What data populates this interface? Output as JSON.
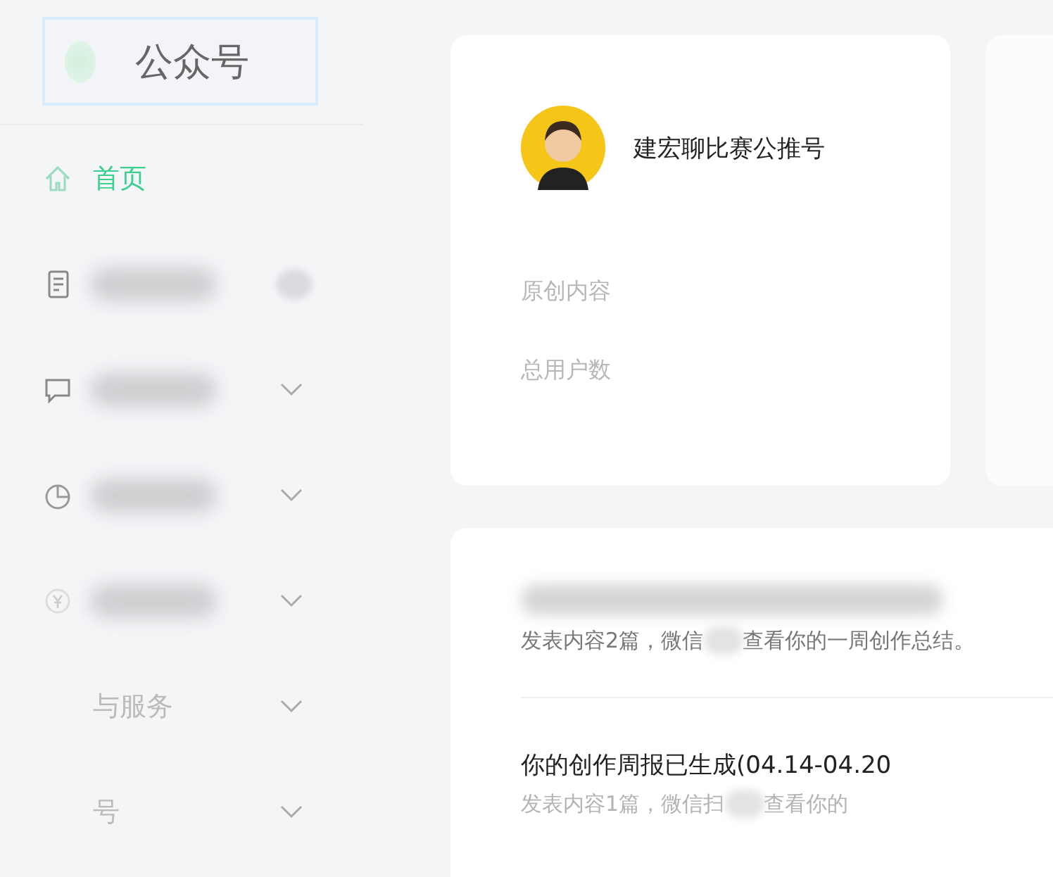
{
  "sidebar": {
    "logo": {
      "title": "公众号"
    },
    "items": [
      {
        "kind": "home",
        "label": "首页",
        "selected": true,
        "expandable": false,
        "badge": false
      },
      {
        "kind": "document",
        "selected": false,
        "expandable": false,
        "badge": true
      },
      {
        "kind": "chat",
        "selected": false,
        "expandable": true,
        "badge": false
      },
      {
        "kind": "pie",
        "selected": false,
        "expandable": true,
        "badge": false
      },
      {
        "kind": "yen",
        "selected": false,
        "expandable": true,
        "badge": false
      },
      {
        "kind": "text",
        "label": "与服务",
        "selected": false,
        "expandable": true,
        "badge": false
      },
      {
        "kind": "text",
        "label": "号",
        "selected": false,
        "expandable": true,
        "badge": false
      }
    ]
  },
  "account_card": {
    "name": "建宏聊比赛公推号",
    "stats": [
      {
        "label": "原创内容"
      },
      {
        "label": "总用户数"
      }
    ]
  },
  "notices": [
    {
      "title_blurred": true,
      "text_before": "发表内容2篇，微信",
      "text_after": "查看你的一周创作总结。"
    },
    {
      "title": "你的创作周报已生成(04.14-04.20",
      "text_before": "发表内容1篇，微信扫",
      "text_after": "查看你的"
    }
  ]
}
